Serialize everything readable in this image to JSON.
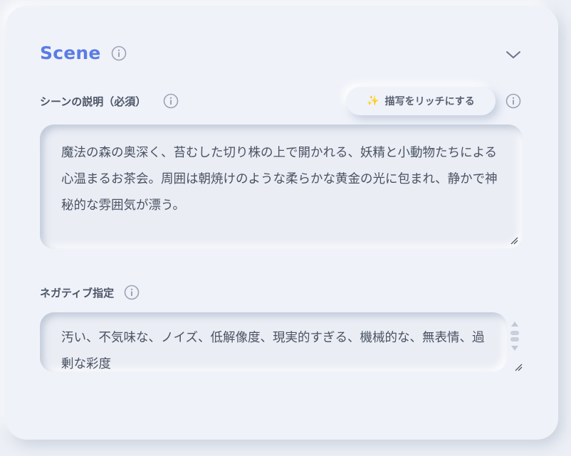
{
  "section": {
    "title": "Scene"
  },
  "description_field": {
    "label": "シーンの説明（必須）",
    "value": "魔法の森の奥深く、苔むした切り株の上で開かれる、妖精と小動物たちによる心温まるお茶会。周囲は朝焼けのような柔らかな黄金の光に包まれ、静かで神秘的な雰囲気が漂う。"
  },
  "enrich_button": {
    "icon": "sparkles-icon",
    "label": "描写をリッチにする"
  },
  "negative_field": {
    "label": "ネガティブ指定",
    "value": "汚い、不気味な、ノイズ、低解像度、現実的すぎる、機械的な、無表情、過剰な彩度"
  },
  "colors": {
    "accent": "#5b7ce5",
    "background": "#eff2f9",
    "text": "#4a5262",
    "sparkle": "#e8b23a"
  }
}
